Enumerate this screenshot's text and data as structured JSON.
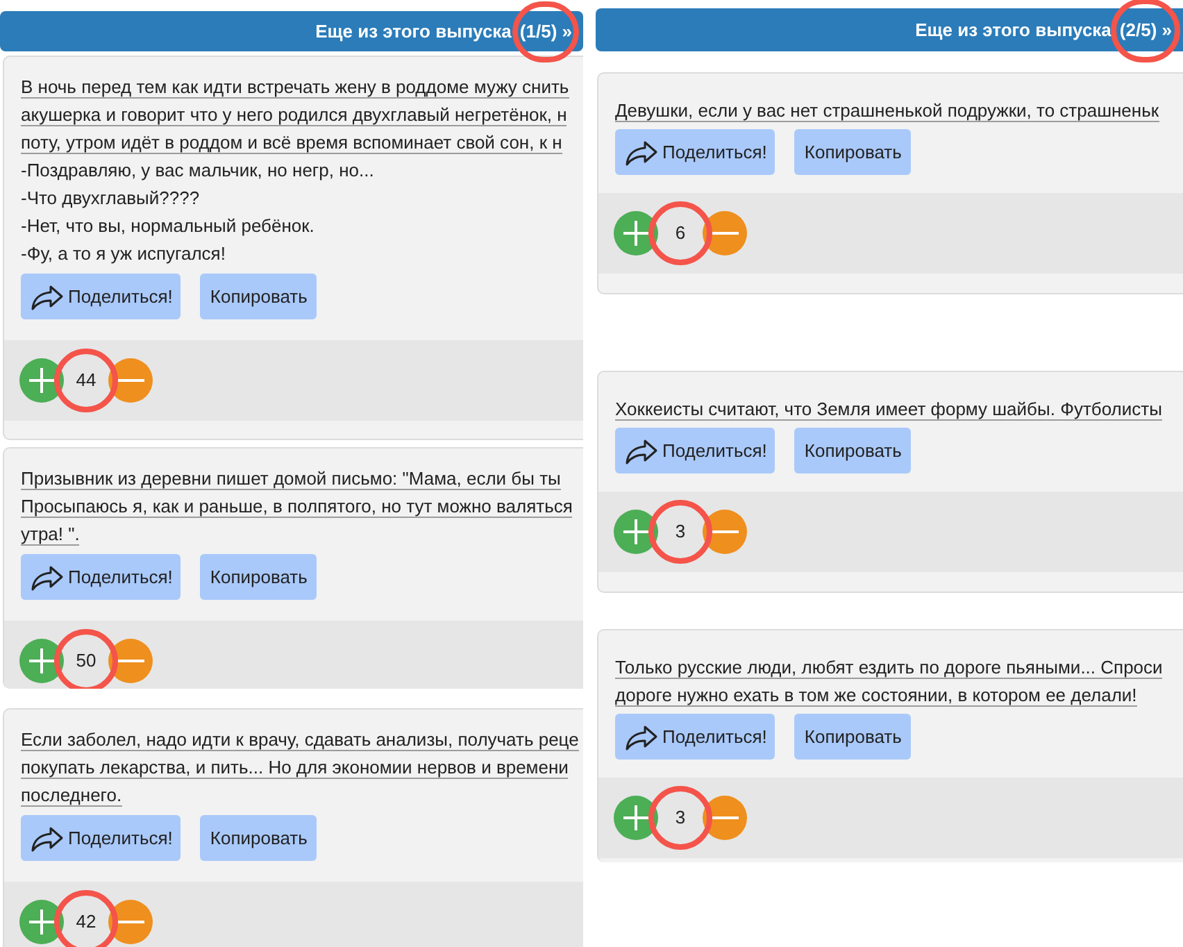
{
  "panels": [
    {
      "header": {
        "title": "Еще из этого выпуска",
        "counter": "(1/5) »",
        "counter_circled": true
      },
      "jokes": [
        {
          "paragraphs": [
            {
              "lines": [
                "В ночь перед тем как идти встречать жену в роддоме мужу снить",
                "акушерка и говорит что у него родился двухглавый негретёнок, н",
                "поту, утром идёт в роддом и всё время вспоминает свой сон, к н"
              ],
              "underlined": true
            },
            {
              "lines": [
                "-Поздравляю, у вас мальчик, но негр, но...",
                "-Что двухглавый????",
                "-Нет, что вы, нормальный ребёнок.",
                "-Фу, а то я уж испугался!"
              ],
              "underlined": false
            }
          ],
          "share_button": "Поделиться!",
          "copy_button": "Копировать",
          "rating": "44",
          "rating_circled": true
        },
        {
          "paragraphs": [
            {
              "lines": [
                "Призывник из деревни пишет домой письмо: \"Мама, если бы ты",
                "Просыпаюсь я, как и раньше, в полпятого, но тут можно валяться",
                "утра! \"."
              ],
              "underlined": true
            }
          ],
          "share_button": "Поделиться!",
          "copy_button": "Копировать",
          "rating": "50",
          "rating_circled": true
        },
        {
          "paragraphs": [
            {
              "lines": [
                "Если заболел, надо идти к врачу, сдавать анализы, получать реце",
                "покупать лекарства, и пить... Но для экономии нервов и времени",
                "последнего."
              ],
              "underlined": true
            }
          ],
          "share_button": "Поделиться!",
          "copy_button": "Копировать",
          "rating": "42",
          "rating_circled": true
        }
      ]
    },
    {
      "header": {
        "title": "Еще из этого выпуска",
        "counter": "(2/5) »",
        "counter_circled": true
      },
      "jokes": [
        {
          "paragraphs": [
            {
              "lines": [
                "Девушки, если у вас нет страшненькой подружки, то страшненьк"
              ],
              "underlined": true
            }
          ],
          "share_button": "Поделиться!",
          "copy_button": "Копировать",
          "rating": "6",
          "rating_circled": true
        },
        {
          "paragraphs": [
            {
              "lines": [
                "Хоккеисты считают, что Земля имеет форму шайбы. Футболисты"
              ],
              "underlined": true
            }
          ],
          "share_button": "Поделиться!",
          "copy_button": "Копировать",
          "rating": "3",
          "rating_circled": true
        },
        {
          "paragraphs": [
            {
              "lines": [
                "Только русские люди, любят ездить по дороге пьяными... Спроси",
                "дороге нужно ехать в том же состоянии, в котором ее делали!"
              ],
              "underlined": true
            }
          ],
          "share_button": "Поделиться!",
          "copy_button": "Копировать",
          "rating": "3",
          "rating_circled": true
        }
      ]
    }
  ]
}
